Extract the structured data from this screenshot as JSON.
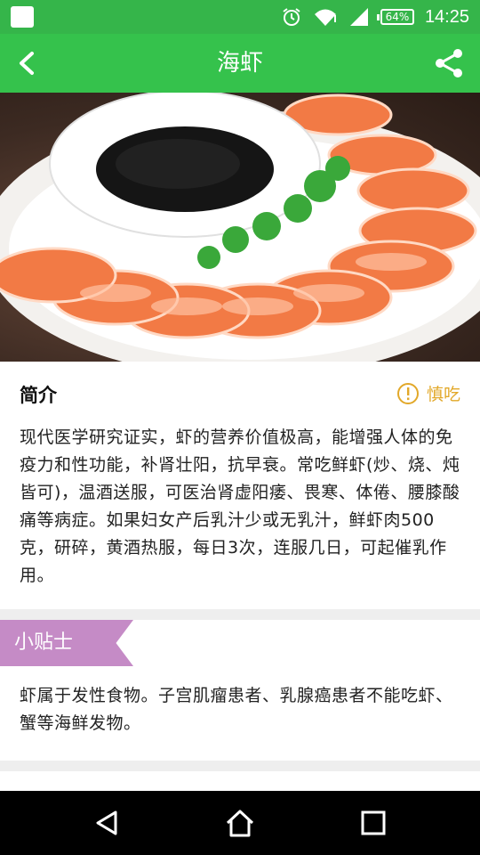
{
  "status_bar": {
    "battery": "64%",
    "time": "14:25",
    "icons": [
      "notification-icon",
      "alarm-icon",
      "wifi-icon",
      "signal-icon",
      "battery-icon"
    ]
  },
  "app_bar": {
    "title": "海虾",
    "back_icon": "back-arrow-icon",
    "share_icon": "share-icon",
    "color": "#35c24c"
  },
  "intro": {
    "heading": "简介",
    "caution_label": "慎吃",
    "caution_color": "#e2a829",
    "body": "现代医学研究证实，虾的营养价值极高，能增强人体的免疫力和性功能，补肾壮阳，抗早衰。常吃鲜虾(炒、烧、炖皆可)，温酒送服，可医治肾虚阳痿、畏寒、体倦、腰膝酸痛等病症。如果妇女产后乳汁少或无乳汁，鲜虾肉500克，研碎，黄酒热服，每日3次，连服几日，可起催乳作用。"
  },
  "tips": {
    "badge": "小贴士",
    "badge_color": "#c58bc6",
    "body": "虾属于发性食物。子宫肌瘤患者、乳腺癌患者不能吃虾、蟹等海鲜发物。"
  },
  "nav_bar": {
    "icons": [
      "nav-back-icon",
      "nav-home-icon",
      "nav-recents-icon"
    ]
  }
}
